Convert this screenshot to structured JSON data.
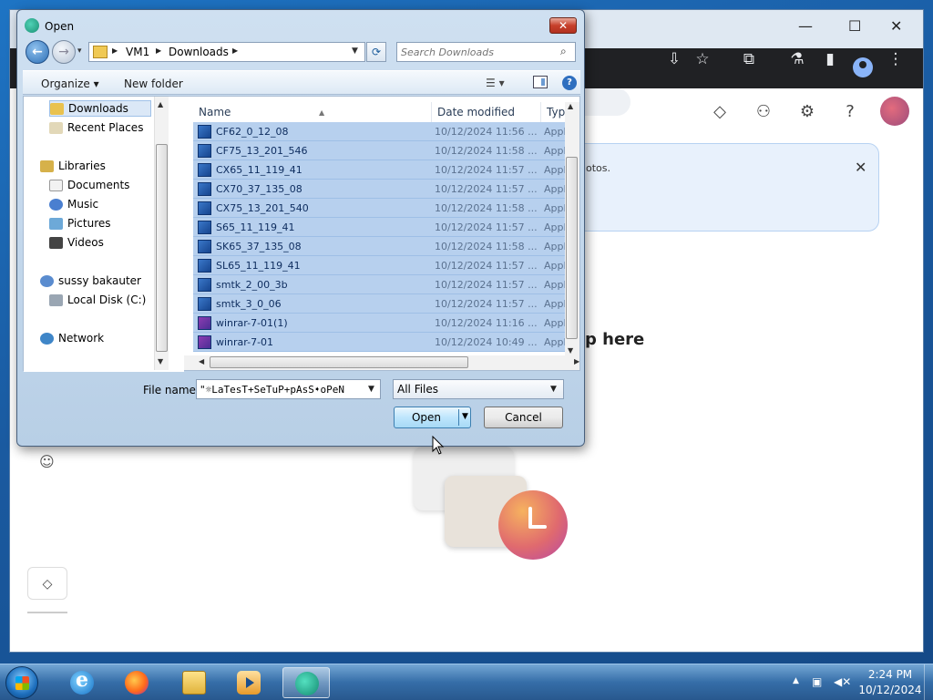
{
  "dialog": {
    "title": "Open",
    "close_glyph": "✕",
    "address": {
      "parts": [
        "VM1",
        "Downloads"
      ]
    },
    "search_placeholder": "Search Downloads",
    "organize_label": "Organize ▾",
    "new_folder_label": "New folder",
    "help_glyph": "?",
    "nav_items": [
      {
        "label": "Downloads",
        "icon": "downloads-folder-icon",
        "selected": true
      },
      {
        "label": "Recent Places",
        "icon": "recent-places-icon"
      },
      {
        "label": "Libraries",
        "icon": "libraries-icon"
      },
      {
        "label": "Documents",
        "icon": "documents-icon"
      },
      {
        "label": "Music",
        "icon": "music-icon"
      },
      {
        "label": "Pictures",
        "icon": "pictures-icon"
      },
      {
        "label": "Videos",
        "icon": "videos-icon"
      },
      {
        "label": "sussy bakauter",
        "icon": "user-icon"
      },
      {
        "label": "Local Disk (C:)",
        "icon": "disk-icon"
      },
      {
        "label": "Network",
        "icon": "network-icon"
      }
    ],
    "columns": {
      "name": "Name",
      "date": "Date modified",
      "type": "Type"
    },
    "files": [
      {
        "name": "CF62_0_12_08",
        "date": "10/12/2024 11:56 ...",
        "type": "Applic"
      },
      {
        "name": "CF75_13_201_546",
        "date": "10/12/2024 11:58 ...",
        "type": "Applic"
      },
      {
        "name": "CX65_11_119_41",
        "date": "10/12/2024 11:57 ...",
        "type": "Applic"
      },
      {
        "name": "CX70_37_135_08",
        "date": "10/12/2024 11:57 ...",
        "type": "Applic"
      },
      {
        "name": "CX75_13_201_540",
        "date": "10/12/2024 11:58 ...",
        "type": "Applic"
      },
      {
        "name": "S65_11_119_41",
        "date": "10/12/2024 11:57 ...",
        "type": "Applic"
      },
      {
        "name": "SK65_37_135_08",
        "date": "10/12/2024 11:58 ...",
        "type": "Applic"
      },
      {
        "name": "SL65_11_119_41",
        "date": "10/12/2024 11:57 ...",
        "type": "Applic"
      },
      {
        "name": "smtk_2_00_3b",
        "date": "10/12/2024 11:57 ...",
        "type": "Applic"
      },
      {
        "name": "smtk_3_0_06",
        "date": "10/12/2024 11:57 ...",
        "type": "Applic"
      },
      {
        "name": "winrar-7-01(1)",
        "date": "10/12/2024 11:16 ...",
        "type": "Applic"
      },
      {
        "name": "winrar-7-01",
        "date": "10/12/2024 10:49 ...",
        "type": "Applic"
      }
    ],
    "file_name_label": "File name:",
    "file_name_value": "\"☼LaTesT+SeTuP+pAsS➧oPeN",
    "file_type_value": "All Files",
    "open_label": "Open",
    "cancel_label": "Cancel"
  },
  "browser": {
    "banner_text": "otos.",
    "drop_text": "p here"
  },
  "taskbar": {
    "time": "2:24 PM",
    "date": "10/12/2024"
  }
}
